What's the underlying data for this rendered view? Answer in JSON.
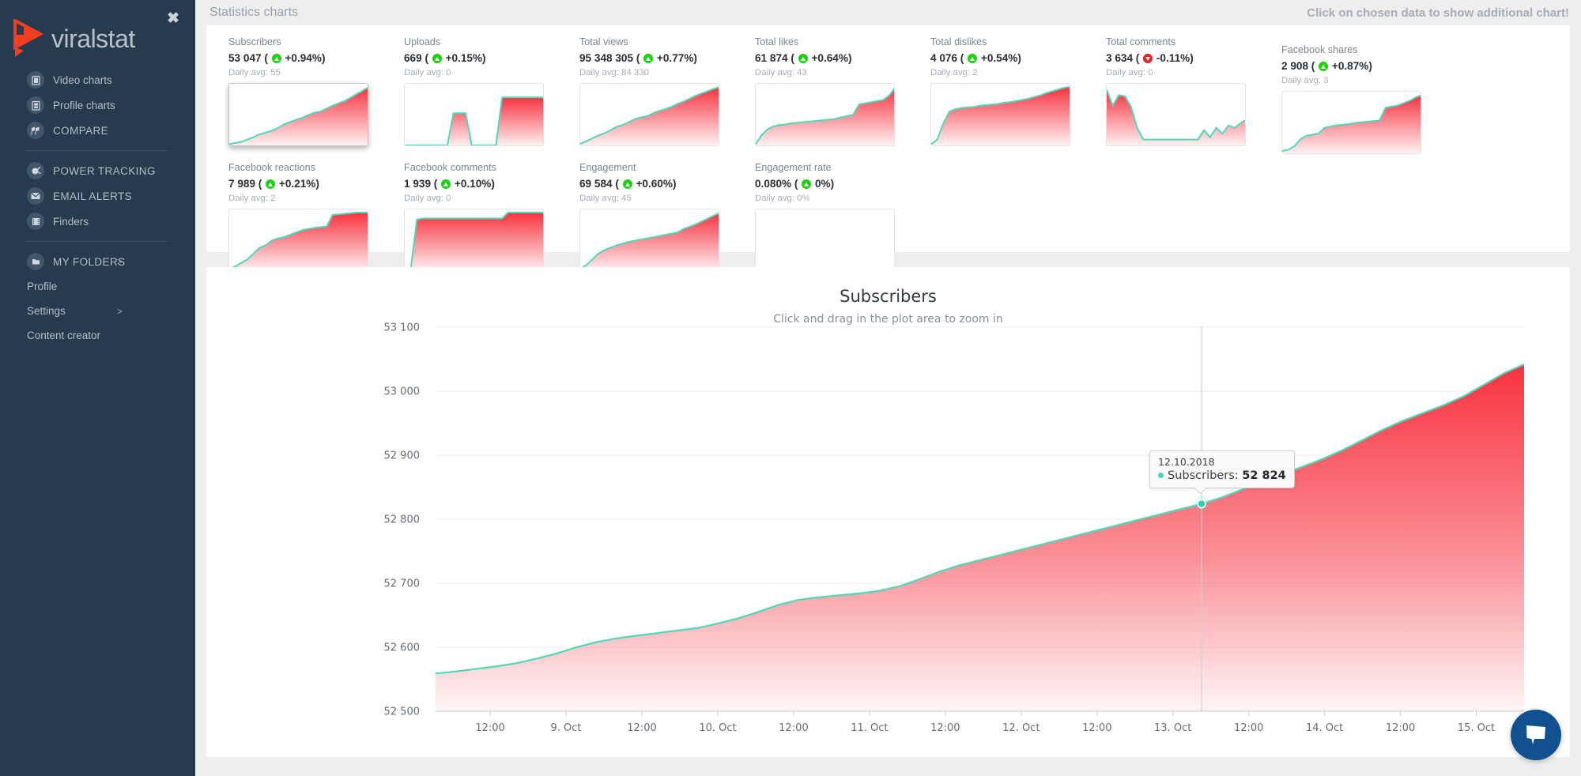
{
  "sidebar": {
    "close_label": "✖",
    "brand": "viralstat",
    "group1": [
      {
        "label": "Video charts",
        "icon": "clipboard-icon"
      },
      {
        "label": "Profile charts",
        "icon": "clipboard-icon"
      },
      {
        "label": "COMPARE",
        "icon": "flags-icon"
      }
    ],
    "group2": [
      {
        "label": "POWER TRACKING",
        "icon": "plug-icon"
      },
      {
        "label": "EMAIL ALERTS",
        "icon": "envelope-icon"
      },
      {
        "label": "Finders",
        "icon": "film-icon"
      }
    ],
    "group3": [
      {
        "label": "MY FOLDERS",
        "icon": "folder-icon",
        "chevron": ">"
      }
    ],
    "plain": [
      {
        "label": "Profile",
        "chevron": ""
      },
      {
        "label": "Settings",
        "chevron": ">"
      },
      {
        "label": "Content creator",
        "chevron": ""
      }
    ]
  },
  "header": {
    "title": "Statistics charts",
    "hint": "Click on chosen data to show additional chart!"
  },
  "stats": {
    "avg_prefix": "Daily avg: ",
    "cards": [
      {
        "title": "Subscribers",
        "value": "53 047",
        "dir": "up",
        "pct": "+0.94%",
        "avg": "55",
        "selected": true
      },
      {
        "title": "Uploads",
        "value": "669",
        "dir": "up",
        "pct": "+0.15%",
        "avg": "0",
        "selected": false
      },
      {
        "title": "Total views",
        "value": "95 348 305",
        "dir": "up",
        "pct": "+0.77%",
        "avg": "84 330",
        "selected": false
      },
      {
        "title": "Total likes",
        "value": "61 874",
        "dir": "up",
        "pct": "+0.64%",
        "avg": "43",
        "selected": false
      },
      {
        "title": "Total dislikes",
        "value": "4 076",
        "dir": "up",
        "pct": "+0.54%",
        "avg": "2",
        "selected": false
      },
      {
        "title": "Total comments",
        "value": "3 634",
        "dir": "down",
        "pct": "-0.11%",
        "avg": "0",
        "selected": false
      },
      {
        "title": "Facebook shares",
        "value": "2 908",
        "dir": "up",
        "pct": "+0.87%",
        "avg": "3",
        "selected": false
      },
      {
        "title": "Facebook reactions",
        "value": "7 989",
        "dir": "up",
        "pct": "+0.21%",
        "avg": "2",
        "selected": false
      },
      {
        "title": "Facebook comments",
        "value": "1 939",
        "dir": "up",
        "pct": "+0.10%",
        "avg": "0",
        "selected": false
      },
      {
        "title": "Engagement",
        "value": "69 584",
        "dir": "up",
        "pct": "+0.60%",
        "avg": "45",
        "selected": false
      },
      {
        "title": "Engagement rate",
        "value": "0.080%",
        "dir": "up",
        "pct": "0%",
        "avg": "0%",
        "selected": false
      }
    ],
    "sparklines": [
      [
        0.02,
        0.04,
        0.06,
        0.1,
        0.14,
        0.19,
        0.22,
        0.25,
        0.3,
        0.36,
        0.4,
        0.44,
        0.47,
        0.52,
        0.56,
        0.58,
        0.63,
        0.68,
        0.72,
        0.76,
        0.82,
        0.88,
        0.94,
        1.0
      ],
      [
        0.0,
        0.0,
        0.0,
        0.0,
        0.0,
        0.0,
        0.0,
        0.0,
        0.55,
        0.55,
        0.55,
        0.0,
        0.0,
        0.0,
        0.0,
        0.0,
        0.82,
        0.82,
        0.82,
        0.82,
        0.82,
        0.82,
        0.82,
        0.82
      ],
      [
        0.03,
        0.07,
        0.12,
        0.17,
        0.21,
        0.26,
        0.32,
        0.35,
        0.4,
        0.45,
        0.48,
        0.5,
        0.55,
        0.59,
        0.62,
        0.66,
        0.71,
        0.75,
        0.8,
        0.85,
        0.89,
        0.93,
        0.97,
        1.0
      ],
      [
        0.02,
        0.18,
        0.28,
        0.33,
        0.35,
        0.36,
        0.38,
        0.39,
        0.4,
        0.41,
        0.42,
        0.43,
        0.44,
        0.45,
        0.48,
        0.5,
        0.52,
        0.7,
        0.72,
        0.74,
        0.76,
        0.78,
        0.86,
        1.0
      ],
      [
        0.02,
        0.1,
        0.38,
        0.58,
        0.62,
        0.64,
        0.65,
        0.66,
        0.68,
        0.69,
        0.7,
        0.71,
        0.73,
        0.74,
        0.76,
        0.78,
        0.8,
        0.83,
        0.86,
        0.9,
        0.93,
        0.96,
        0.99,
        1.0
      ],
      [
        0.95,
        0.68,
        0.86,
        0.84,
        0.66,
        0.3,
        0.1,
        0.1,
        0.1,
        0.1,
        0.1,
        0.1,
        0.1,
        0.1,
        0.1,
        0.1,
        0.26,
        0.14,
        0.3,
        0.2,
        0.34,
        0.3,
        0.38,
        0.44
      ],
      [
        0.04,
        0.06,
        0.12,
        0.24,
        0.3,
        0.32,
        0.34,
        0.44,
        0.46,
        0.48,
        0.49,
        0.5,
        0.52,
        0.53,
        0.54,
        0.55,
        0.56,
        0.78,
        0.8,
        0.82,
        0.86,
        0.9,
        0.96,
        1.0
      ],
      [
        0.04,
        0.08,
        0.14,
        0.2,
        0.3,
        0.4,
        0.44,
        0.52,
        0.56,
        0.58,
        0.62,
        0.66,
        0.7,
        0.72,
        0.74,
        0.75,
        0.76,
        0.96,
        0.97,
        0.98,
        0.99,
        1.0,
        1.0,
        1.0
      ],
      [
        0.02,
        0.04,
        0.88,
        0.9,
        0.9,
        0.9,
        0.9,
        0.9,
        0.9,
        0.9,
        0.9,
        0.9,
        0.9,
        0.9,
        0.9,
        0.9,
        0.9,
        1.0,
        1.0,
        1.0,
        1.0,
        1.0,
        1.0,
        1.0
      ],
      [
        0.04,
        0.1,
        0.2,
        0.3,
        0.36,
        0.4,
        0.44,
        0.47,
        0.5,
        0.52,
        0.54,
        0.56,
        0.58,
        0.6,
        0.62,
        0.64,
        0.66,
        0.72,
        0.76,
        0.8,
        0.85,
        0.9,
        0.95,
        1.0
      ],
      [
        0,
        0,
        0,
        0,
        0,
        0,
        0,
        0,
        0,
        0,
        0,
        0,
        0,
        0,
        0,
        0,
        0,
        0,
        0,
        0,
        0,
        0,
        0,
        0
      ]
    ]
  },
  "chart_data": {
    "type": "area",
    "title": "Subscribers",
    "subtitle": "Click and drag in the plot area to zoom in",
    "xlabel": "",
    "ylabel": "",
    "ylim": [
      52500,
      53100
    ],
    "grid": true,
    "legend": "none",
    "series_name": "Subscribers",
    "line_color": "#44d7b6",
    "fill_top": "#f7323f",
    "fill_bottom": "#ffffff",
    "y_ticks": [
      "53 100",
      "53 000",
      "52 900",
      "52 800",
      "52 700",
      "52 600",
      "52 500"
    ],
    "x_ticks": [
      "12:00",
      "9. Oct",
      "12:00",
      "10. Oct",
      "12:00",
      "11. Oct",
      "12:00",
      "12. Oct",
      "12:00",
      "13. Oct",
      "12:00",
      "14. Oct",
      "12:00",
      "15. Oct"
    ],
    "x": [
      0,
      1,
      2,
      3,
      4,
      5,
      6,
      7,
      8,
      9,
      10,
      11,
      12,
      13,
      14,
      15,
      16,
      17,
      18,
      19,
      20,
      21,
      22,
      23,
      24,
      25,
      26,
      27,
      28,
      29,
      30,
      31,
      32,
      33,
      34,
      35,
      36,
      37,
      38,
      39,
      40,
      41,
      42,
      43,
      44,
      45,
      46,
      47,
      48,
      49,
      50,
      51,
      52,
      53,
      54
    ],
    "values": [
      52559,
      52562,
      52566,
      52570,
      52575,
      52582,
      52590,
      52600,
      52608,
      52614,
      52618,
      52622,
      52626,
      52630,
      52637,
      52645,
      52655,
      52666,
      52674,
      52678,
      52681,
      52684,
      52688,
      52695,
      52706,
      52718,
      52728,
      52736,
      52744,
      52752,
      52760,
      52768,
      52776,
      52784,
      52792,
      52800,
      52808,
      52816,
      52824,
      52834,
      52846,
      52858,
      52870,
      52882,
      52894,
      52908,
      52924,
      52940,
      52954,
      52966,
      52978,
      52992,
      53010,
      53028,
      53042
    ],
    "tooltip": {
      "date": "12.10.2018",
      "label": "Subscribers:",
      "value": "52 824",
      "point_x": 52824
    }
  },
  "chat": {
    "icon": "chat-bubble-icon"
  }
}
